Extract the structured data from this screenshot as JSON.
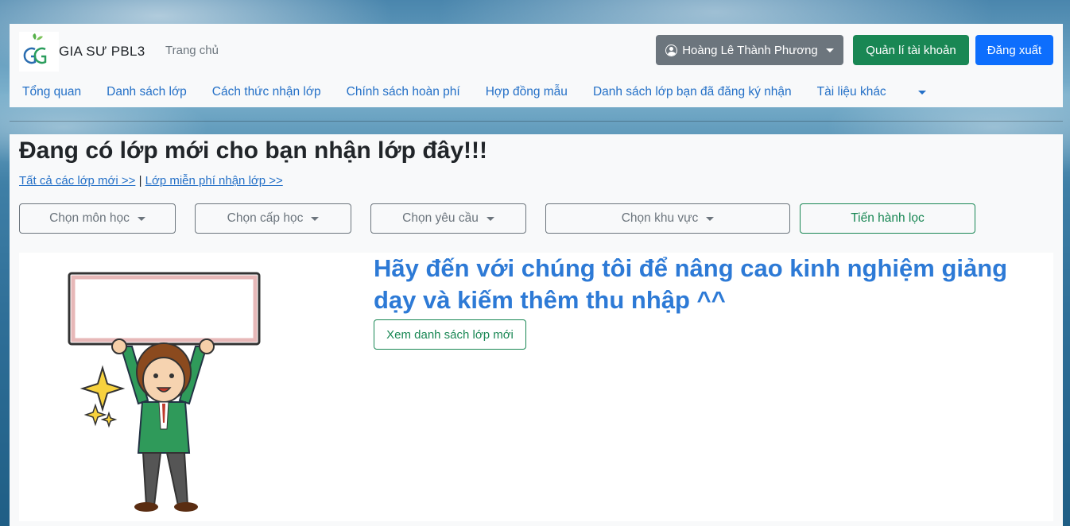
{
  "navbar": {
    "brand": "GIA SƯ PBL3",
    "home": "Trang chủ",
    "user_button": "Hoàng Lê Thành Phương",
    "manage_button": "Quản lí tài khoản",
    "logout_button": "Đăng xuất",
    "menu": [
      "Tổng quan",
      "Danh sách lớp",
      "Cách thức nhận lớp",
      "Chính sách hoàn phí",
      "Hợp đồng mẫu",
      "Danh sách lớp bạn đã đăng ký nhận",
      "Tài liệu khác"
    ]
  },
  "main": {
    "title": "Đang có lớp mới cho bạn nhận lớp đây!!!",
    "link_all": "Tất cả các lớp mới >>",
    "separator": "|",
    "link_free": "Lớp miễn phí nhận lớp >>",
    "filters": {
      "subject": "Chọn môn học",
      "level": "Chọn cấp học",
      "requirement": "Chọn yêu cầu",
      "area": "Chọn khu vực",
      "apply": "Tiến hành lọc"
    },
    "hero": {
      "title": "Hãy đến với chúng tôi để nâng cao kinh nghiệm giảng dạy và kiếm thêm thu nhập ^^",
      "button": "Xem danh sách lớp mới"
    }
  },
  "colors": {
    "primary_blue": "#0d6efd",
    "success_green": "#198754",
    "secondary_gray": "#6c757d",
    "link_blue": "#2470c7",
    "hero_blue": "#2d7ad6"
  }
}
